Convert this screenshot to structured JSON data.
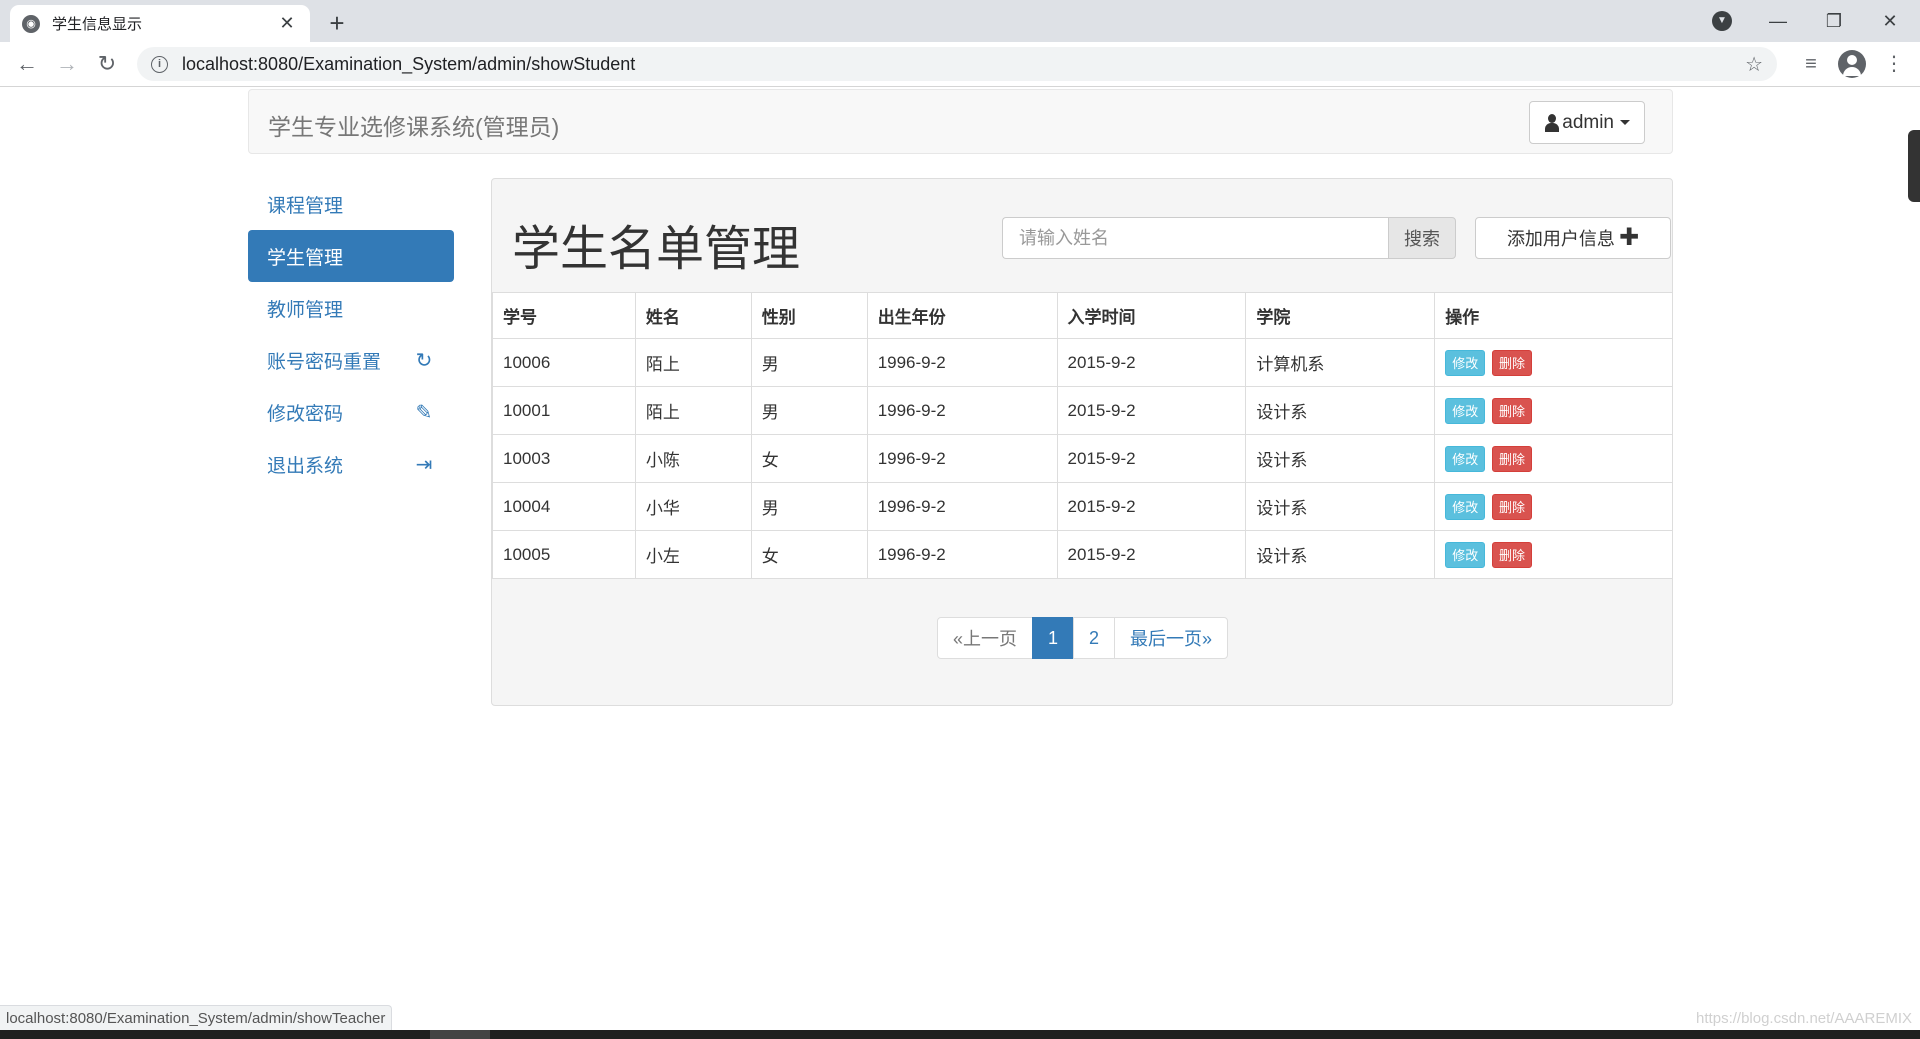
{
  "browser": {
    "tab_title": "学生信息显示",
    "tab_close": "✕",
    "new_tab": "+",
    "url": "localhost:8080/Examination_System/admin/showStudent",
    "status_url": "localhost:8080/Examination_System/admin/showTeacher"
  },
  "navbar": {
    "brand": "学生专业选修课系统(管理员)",
    "user": "admin"
  },
  "sidebar": {
    "items": [
      {
        "label": "课程管理"
      },
      {
        "label": "学生管理"
      },
      {
        "label": "教师管理"
      },
      {
        "label": "账号密码重置"
      },
      {
        "label": "修改密码"
      },
      {
        "label": "退出系统"
      }
    ]
  },
  "main": {
    "title": "学生名单管理",
    "search_placeholder": "请输入姓名",
    "search_button": "搜索",
    "add_button": "添加用户信息",
    "columns": [
      "学号",
      "姓名",
      "性别",
      "出生年份",
      "入学时间",
      "学院",
      "操作"
    ],
    "rows": [
      [
        "10006",
        "陌上",
        "男",
        "1996-9-2",
        "2015-9-2",
        "计算机系"
      ],
      [
        "10001",
        "陌上",
        "男",
        "1996-9-2",
        "2015-9-2",
        "设计系"
      ],
      [
        "10003",
        "小陈",
        "女",
        "1996-9-2",
        "2015-9-2",
        "设计系"
      ],
      [
        "10004",
        "小华",
        "男",
        "1996-9-2",
        "2015-9-2",
        "设计系"
      ],
      [
        "10005",
        "小左",
        "女",
        "1996-9-2",
        "2015-9-2",
        "设计系"
      ]
    ],
    "edit_label": "修改",
    "delete_label": "删除",
    "pagination": {
      "prev": "«上一页",
      "pages": [
        "1",
        "2"
      ],
      "last": "最后一页»"
    }
  },
  "watermark": "https://blog.csdn.net/AAAREMIX",
  "colors": {
    "primary": "#337ab7",
    "info": "#5bc0de",
    "danger": "#d9534f"
  }
}
